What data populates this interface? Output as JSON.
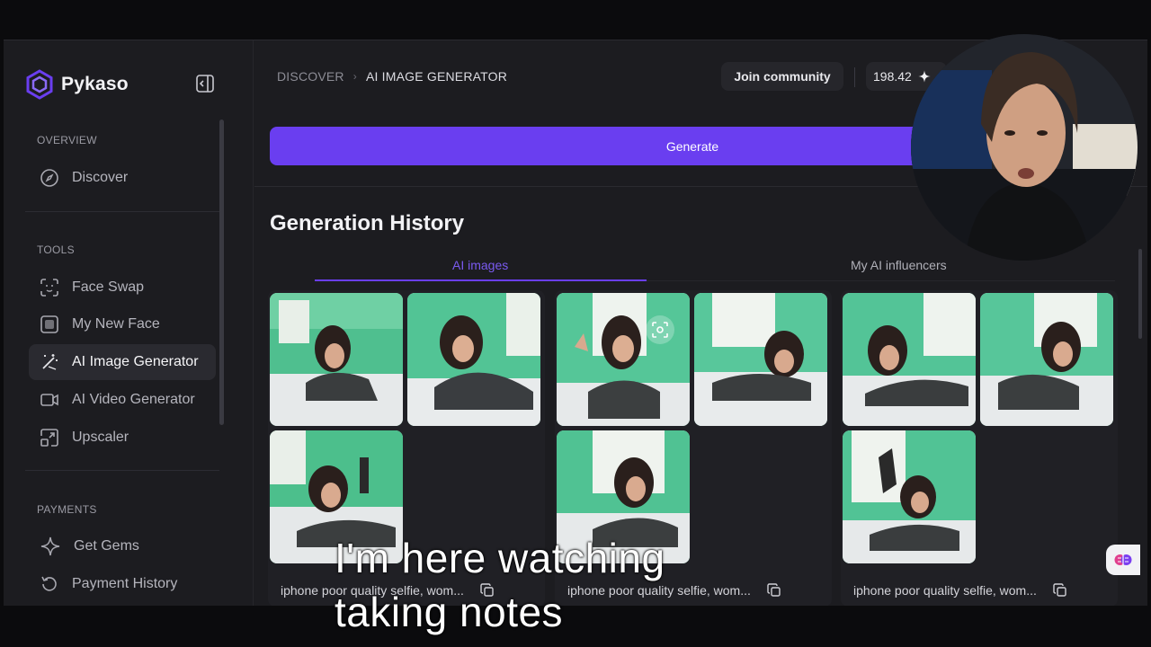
{
  "app": {
    "logo_text": "Pykaso",
    "brand_color": "#6a3ef0"
  },
  "sidebar": {
    "sections": [
      {
        "label": "OVERVIEW"
      },
      {
        "label": "TOOLS"
      },
      {
        "label": "PAYMENTS"
      }
    ],
    "items": [
      {
        "label": "Discover",
        "icon": "compass-icon"
      },
      {
        "label": "Face Swap",
        "icon": "face-scan-icon"
      },
      {
        "label": "My New Face",
        "icon": "face-grid-icon"
      },
      {
        "label": "AI Image Generator",
        "icon": "magic-wand-icon",
        "active": true
      },
      {
        "label": "AI Video Generator",
        "icon": "video-camera-icon"
      },
      {
        "label": "Upscaler",
        "icon": "upscale-icon"
      },
      {
        "label": "Get Gems",
        "icon": "sparkle-icon"
      },
      {
        "label": "Payment History",
        "icon": "history-icon"
      }
    ]
  },
  "header": {
    "breadcrumb": {
      "parent": "DISCOVER",
      "separator": "›",
      "current": "AI IMAGE GENERATOR"
    },
    "join_label": "Join community",
    "gems_value": "198.42"
  },
  "main": {
    "generate_label": "Generate",
    "history_title": "Generation History",
    "tabs": [
      {
        "label": "AI images",
        "active": true
      },
      {
        "label": "My AI influencers",
        "active": false
      }
    ],
    "groups": [
      {
        "prompt": "iphone poor quality selfie, wom...",
        "image_count": 3
      },
      {
        "prompt": "iphone poor quality selfie, wom...",
        "image_count": 3
      },
      {
        "prompt": "iphone poor quality selfie, wom...",
        "image_count": 3
      }
    ]
  },
  "overlay": {
    "caption_line1": "I'm here watching",
    "caption_line2": "taking notes"
  }
}
